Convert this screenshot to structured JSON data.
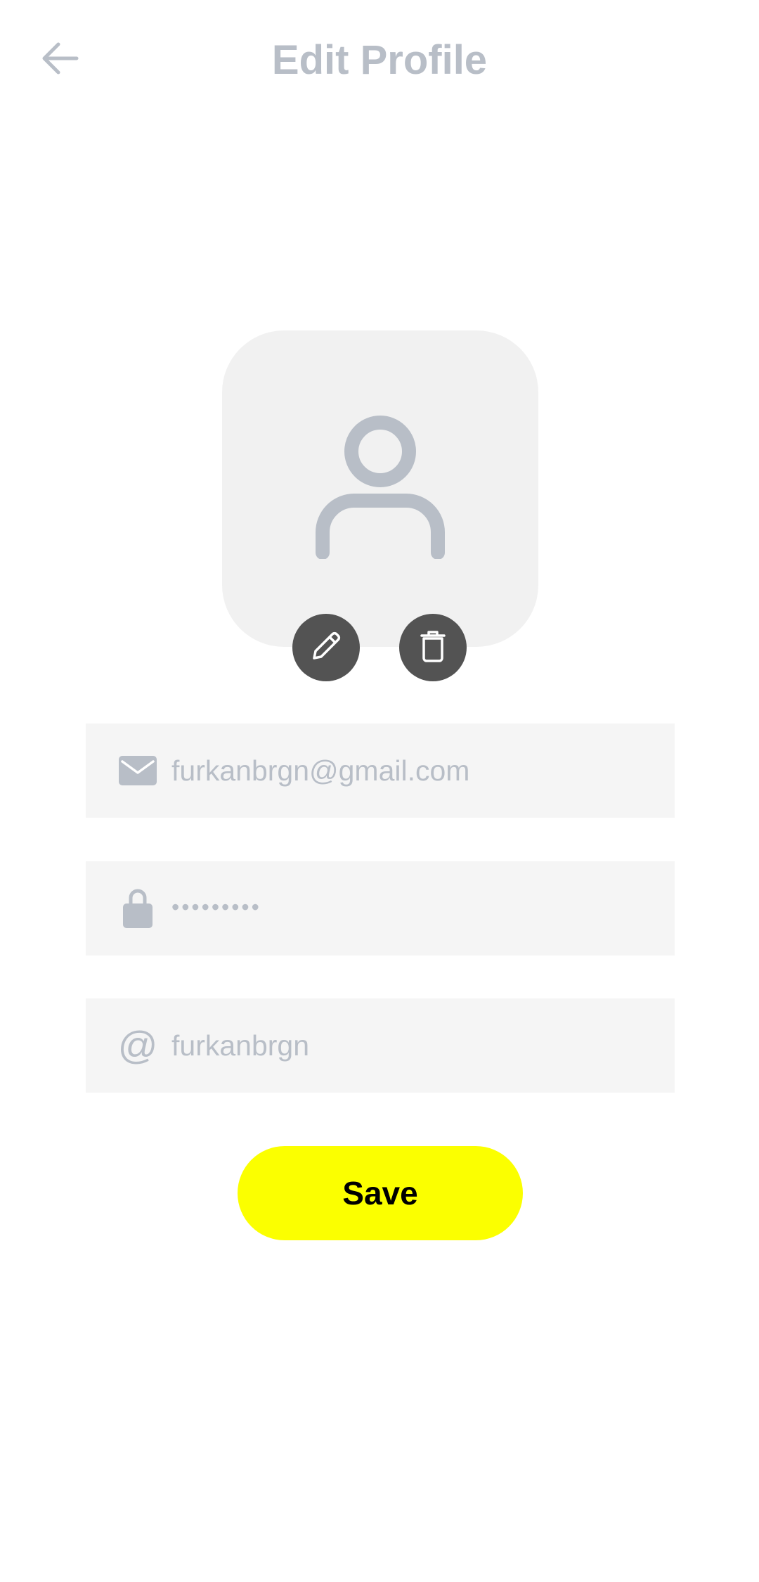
{
  "header": {
    "title": "Edit Profile",
    "back_icon": "arrow-left-icon"
  },
  "avatar": {
    "placeholder_icon": "user-icon",
    "edit_icon": "pencil-icon",
    "delete_icon": "trash-icon"
  },
  "form": {
    "email": {
      "icon": "mail-icon",
      "value": "furkanbrgn@gmail.com"
    },
    "password": {
      "icon": "lock-icon",
      "value": "•••••••••"
    },
    "username": {
      "icon": "at-sign-icon",
      "symbol": "@",
      "value": "furkanbrgn"
    }
  },
  "actions": {
    "save_label": "Save"
  },
  "colors": {
    "accent": "#fbff00",
    "muted_text": "#b8bec7",
    "field_background": "#f5f5f5",
    "avatar_background": "#f1f1f1",
    "action_button": "#535353"
  }
}
